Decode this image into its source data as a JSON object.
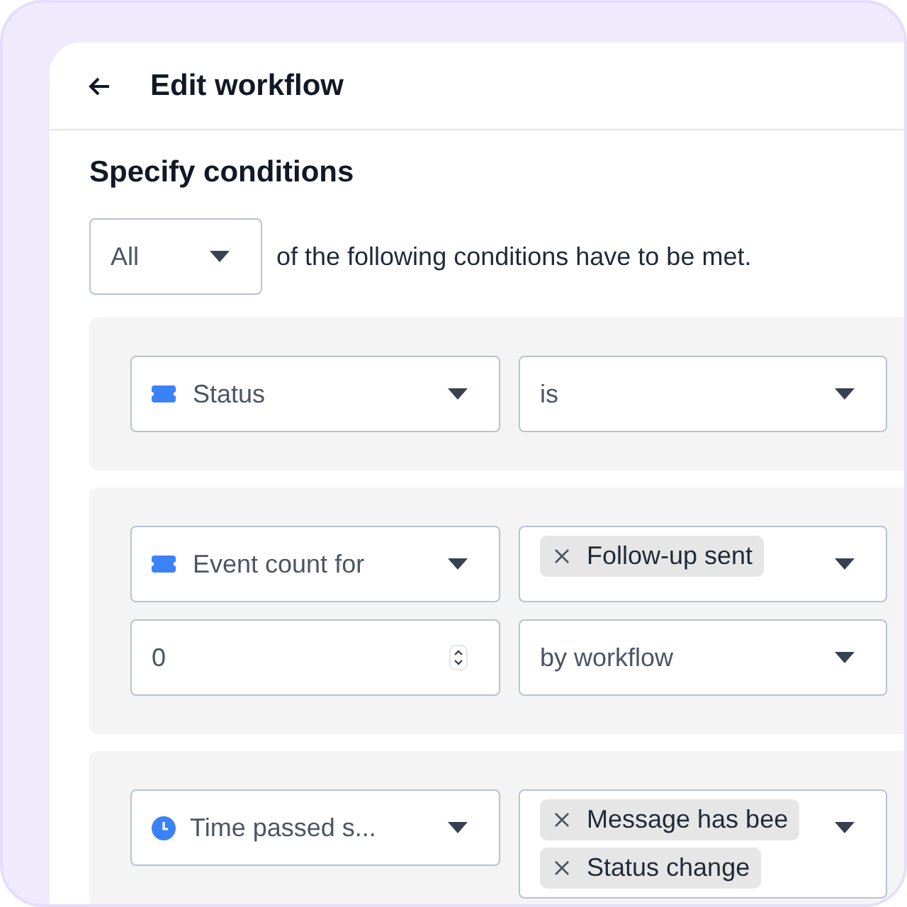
{
  "header": {
    "title": "Edit workflow"
  },
  "section_title": "Specify conditions",
  "match": {
    "value": "All",
    "suffix": "of the following conditions have to be met."
  },
  "conditions": [
    {
      "fields": [
        {
          "kind": "attribute_select",
          "value": "Status"
        },
        {
          "kind": "select",
          "value": "is"
        }
      ]
    },
    {
      "fields": [
        {
          "kind": "attribute_select",
          "value": "Event count for"
        },
        {
          "kind": "chips",
          "chips": [
            "Follow-up sent"
          ]
        },
        {
          "kind": "number",
          "value": "0"
        },
        {
          "kind": "select",
          "value": "by workflow"
        }
      ]
    },
    {
      "fields": [
        {
          "kind": "time_select",
          "value": "Time passed s..."
        },
        {
          "kind": "chips",
          "chips": [
            "Message has bee",
            "Status change"
          ]
        }
      ]
    }
  ]
}
